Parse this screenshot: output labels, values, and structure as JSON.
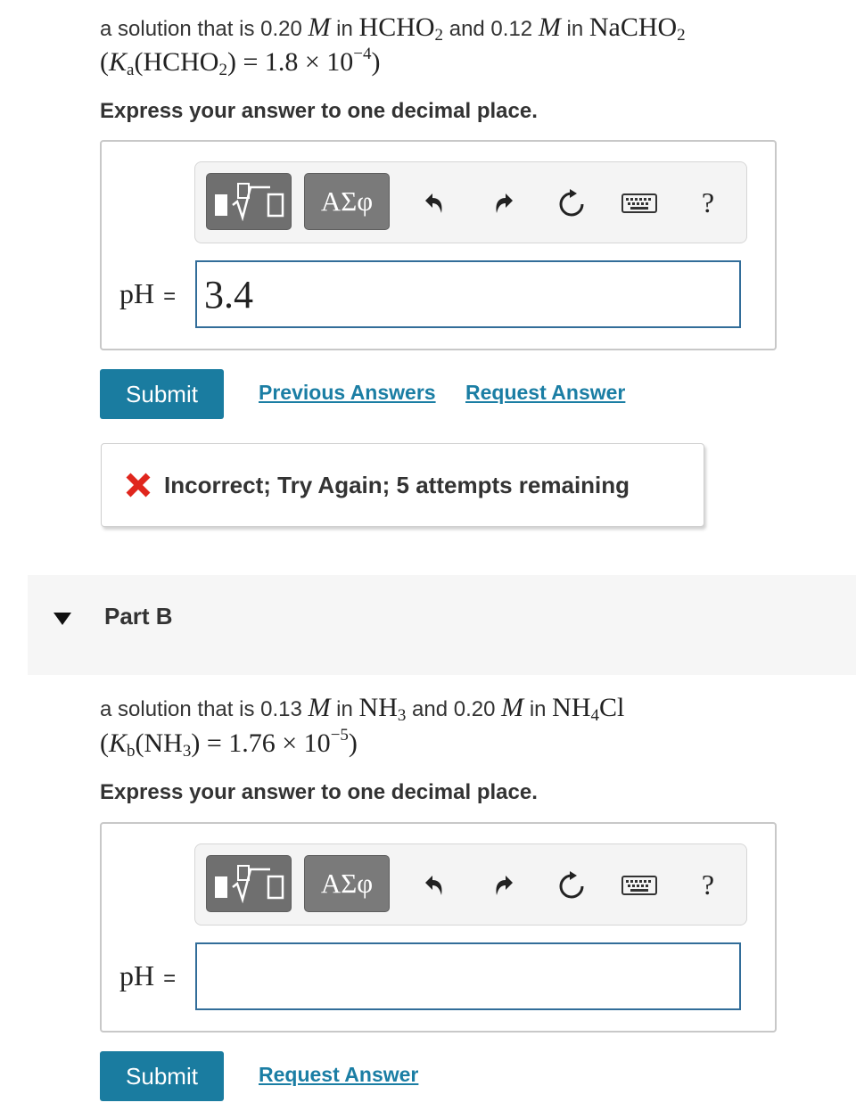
{
  "part_a": {
    "problem": {
      "prefix": "a solution that is 0.20",
      "molarity_symbol": "M",
      "in1": "in",
      "acid_main": "HCHO",
      "acid_sub": "2",
      "and": "and 0.12",
      "in2": "in",
      "salt_main": "NaCHO",
      "salt_sub": "2",
      "const_open": "(",
      "const_symbol": "K",
      "const_sub": "a",
      "const_species_open": "(HCHO",
      "const_species_sub": "2",
      "const_species_close": ")",
      "const_value": " = 1.8 × 10",
      "const_exp": "−4",
      "const_close": ")"
    },
    "instruction": "Express your answer to one decimal place.",
    "toolbar": {
      "template_icon": "square-root-template-icon",
      "greek_label": "ΑΣφ",
      "undo_icon": "undo-icon",
      "redo_icon": "redo-icon",
      "reset_icon": "reset-icon",
      "keyboard_icon": "keyboard-icon",
      "help_label": "?"
    },
    "answer_label": "pH",
    "equals": "=",
    "answer_value": "3.4",
    "submit_label": "Submit",
    "previous_answers_label": "Previous Answers",
    "request_answer_label": "Request Answer",
    "feedback": {
      "icon": "x-icon",
      "text": "Incorrect; Try Again; 5 attempts remaining",
      "icon_color": "#e0261d"
    }
  },
  "part_b": {
    "title": "Part B",
    "problem": {
      "prefix": "a solution that is 0.13",
      "molarity_symbol": "M",
      "in1": "in",
      "base_main": "NH",
      "base_sub": "3",
      "and": "and 0.20",
      "in2": "in",
      "salt_main": "NH",
      "salt_sub": "4",
      "salt_tail": "Cl",
      "const_open": "(",
      "const_symbol": "K",
      "const_sub": "b",
      "const_species_open": "(NH",
      "const_species_sub": "3",
      "const_species_close": ")",
      "const_value": " = 1.76 × 10",
      "const_exp": "−5",
      "const_close": ")"
    },
    "instruction": "Express your answer to one decimal place.",
    "toolbar": {
      "greek_label": "ΑΣφ",
      "help_label": "?"
    },
    "answer_label": "pH",
    "equals": "=",
    "answer_value": "",
    "submit_label": "Submit",
    "request_answer_label": "Request Answer"
  },
  "colors": {
    "accent": "#1a7ca0",
    "link": "#1b7ea4",
    "input_border": "#326d99",
    "error": "#e0261d"
  }
}
